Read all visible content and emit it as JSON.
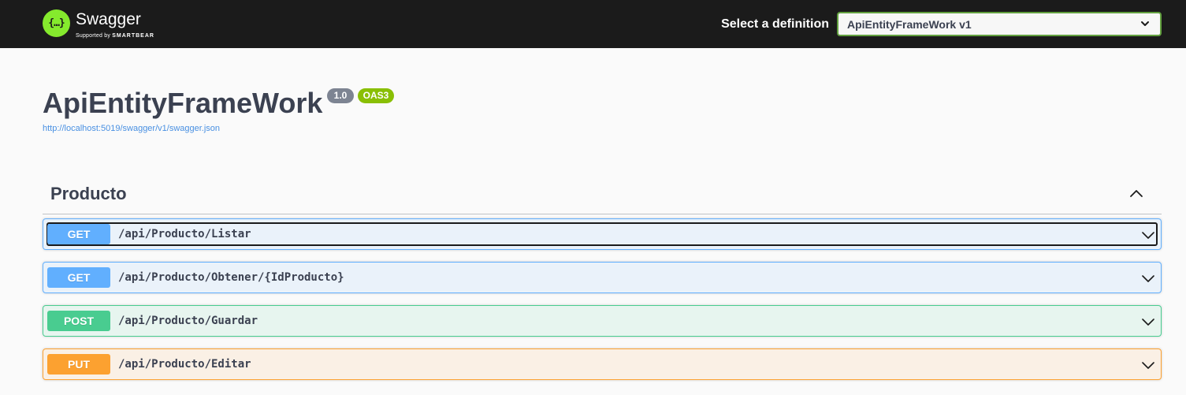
{
  "topbar": {
    "logo_glyph": "{…}",
    "logo_name": "Swagger",
    "logo_tag_prefix": "Supported by",
    "logo_tag_brand": "SMARTBEAR",
    "select_label": "Select a definition",
    "select_value": "ApiEntityFrameWork v1"
  },
  "info": {
    "title": "ApiEntityFrameWork",
    "version": "1.0",
    "oas": "OAS3",
    "spec_url": "http://localhost:5019/swagger/v1/swagger.json"
  },
  "tag": {
    "name": "Producto",
    "toggle_icon": "chevron-up-icon"
  },
  "operations": [
    {
      "method": "GET",
      "path": "/api/Producto/Listar"
    },
    {
      "method": "GET",
      "path": "/api/Producto/Obtener/{IdProducto}"
    },
    {
      "method": "POST",
      "path": "/api/Producto/Guardar"
    },
    {
      "method": "PUT",
      "path": "/api/Producto/Editar"
    }
  ],
  "colors": {
    "topbar": "#1b1b1b",
    "accent": "#85ea2d",
    "get": "#61affe",
    "post": "#49cc90",
    "put": "#fca130"
  }
}
